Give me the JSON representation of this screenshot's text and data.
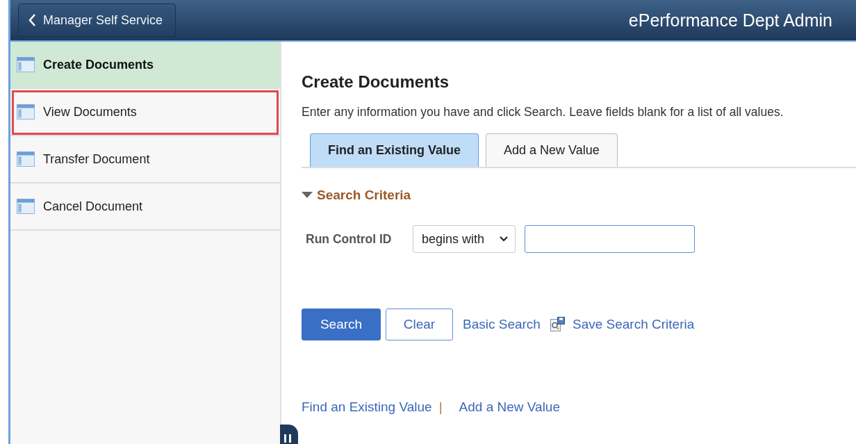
{
  "header": {
    "back_button": {
      "label": "Manager Self Service"
    },
    "title": "ePerformance Dept Admin"
  },
  "sidebar": {
    "items": [
      {
        "label": "Create Documents",
        "selected": true,
        "highlighted": false
      },
      {
        "label": "View Documents",
        "selected": false,
        "highlighted": true
      },
      {
        "label": "Transfer Document",
        "selected": false,
        "highlighted": false
      },
      {
        "label": "Cancel Document",
        "selected": false,
        "highlighted": false
      }
    ]
  },
  "main": {
    "title": "Create Documents",
    "instructions": "Enter any information you have and click Search. Leave fields blank for a list of all values.",
    "tabs": [
      {
        "label": "Find an Existing Value",
        "selected": true
      },
      {
        "label": "Add a New Value",
        "selected": false
      }
    ],
    "section": {
      "title": "Search Criteria",
      "expanded": true
    },
    "fields": [
      {
        "label": "Run Control ID",
        "operator": "begins with"
      }
    ],
    "buttons": [
      {
        "label": "Search",
        "kind": "primary"
      },
      {
        "label": "Clear",
        "kind": "secondary"
      }
    ],
    "links": [
      {
        "label": "Basic Search",
        "kind": "plain"
      },
      {
        "label": "Save Search Criteria",
        "kind": "save"
      }
    ],
    "footer_links": [
      "Find an Existing Value",
      "Add a New Value"
    ],
    "footer_separator": "|"
  }
}
